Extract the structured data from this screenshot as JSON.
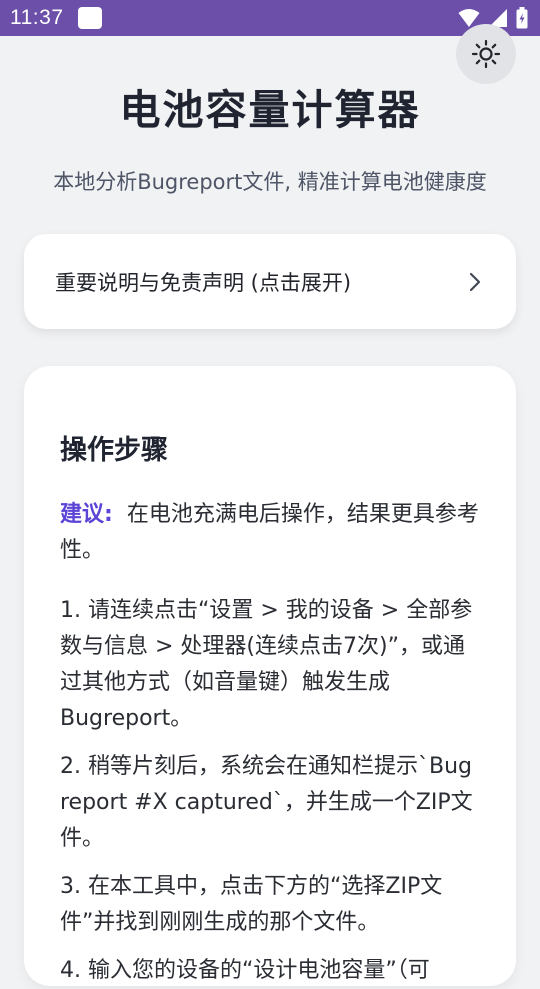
{
  "status_bar": {
    "time": "11:37",
    "icons": [
      "notification-icon",
      "wifi-icon",
      "signal-icon",
      "battery-icon"
    ],
    "color": "#6b4fa8"
  },
  "theme_toggle": {
    "icon": "sun-icon"
  },
  "header": {
    "title": "电池容量计算器",
    "subtitle": "本地分析Bugreport文件, 精准计算电池健康度"
  },
  "disclaimer": {
    "label": "重要说明与免责声明 (点击展开)",
    "icon": "chevron-right-icon"
  },
  "steps": {
    "title": "操作步骤",
    "tip_label": "建议:",
    "tip_text": "在电池充满电后操作，结果更具参考性。",
    "items": [
      "1. 请连续点击“设置 > 我的设备 > 全部参数与信息 > 处理器(连续点击7次)”，或通过其他方式（如音量键）触发生成Bugreport。",
      "2. 稍等片刻后，系统会在通知栏提示`Bug report #X captured`，并生成一个ZIP文件。",
      "3. 在本工具中，点击下方的“选择ZIP文件”并找到刚刚生成的那个文件。",
      "4. 输入您的设备的“设计电池容量”（可"
    ]
  },
  "colors": {
    "accent": "#5b44d6",
    "background": "#f1f2f4",
    "card": "#ffffff"
  }
}
